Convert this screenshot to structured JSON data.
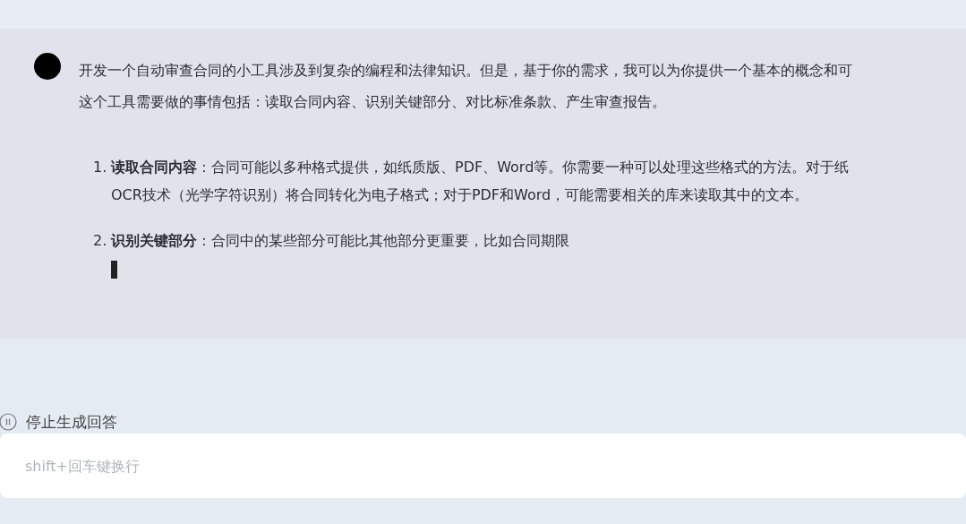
{
  "message": {
    "intro_lines": [
      "开发一个自动审查合同的小工具涉及到复杂的编程和法律知识。但是，基于你的需求，我可以为你提供一个基本的概念和可",
      "这个工具需要做的事情包括：读取合同内容、识别关键部分、对比标准条款、产生审查报告。"
    ],
    "list": [
      {
        "number": "1.",
        "lines": [
          "**读取合同内容**：合同可能以多种格式提供，如纸质版、PDF、Word等。你需要一种可以处理这些格式的方法。对于纸",
          "OCR技术（光学字符识别）将合同转化为电子格式；对于PDF和Word，可能需要相关的库来读取其中的文本。"
        ]
      },
      {
        "number": "2.",
        "lines": [
          "**识别关键部分**：合同中的某些部分可能比其他部分更重要，比如合同期限"
        ]
      }
    ],
    "generating": true
  },
  "stop_button": {
    "label": "停止生成回答"
  },
  "input": {
    "placeholder": "shift+回车键换行"
  }
}
